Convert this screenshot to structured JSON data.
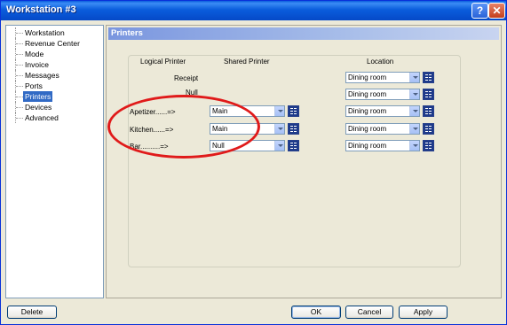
{
  "window": {
    "title": "Workstation #3",
    "help_glyph": "?",
    "close_glyph": "✕"
  },
  "tree": {
    "items": [
      {
        "label": "Workstation",
        "selected": false
      },
      {
        "label": "Revenue Center",
        "selected": false
      },
      {
        "label": "Mode",
        "selected": false
      },
      {
        "label": "Invoice",
        "selected": false
      },
      {
        "label": "Messages",
        "selected": false
      },
      {
        "label": "Ports",
        "selected": false
      },
      {
        "label": "Printers",
        "selected": true
      },
      {
        "label": "Devices",
        "selected": false
      },
      {
        "label": "Advanced",
        "selected": false
      }
    ]
  },
  "panel": {
    "title": "Printers",
    "headers": {
      "logical": "Logical Printer",
      "shared": "Shared Printer",
      "location": "Location"
    },
    "rows": [
      {
        "label": "Receipt",
        "shared": null,
        "location": "Dining room"
      },
      {
        "label": "Null",
        "shared": null,
        "location": "Dining room"
      },
      {
        "label": "Apetizer......=>",
        "shared": "Main",
        "location": "Dining room"
      },
      {
        "label": "Kitchen......=>",
        "shared": "Main",
        "location": "Dining room"
      },
      {
        "label": "Bar..........=>",
        "shared": "Null",
        "location": "Dining room"
      }
    ]
  },
  "buttons": {
    "delete": "Delete",
    "ok": "OK",
    "cancel": "Cancel",
    "apply": "Apply"
  },
  "colors": {
    "annotation": "#e01a1a",
    "selection": "#316ac5"
  },
  "icons": {
    "grid_button": "list-grid-icon",
    "dropdown": "chevron-down-icon"
  }
}
